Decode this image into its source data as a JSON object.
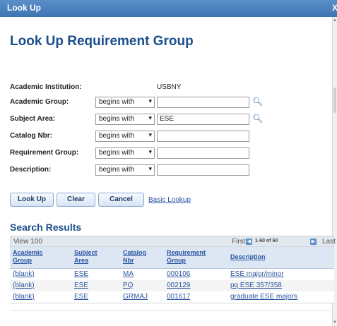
{
  "window": {
    "title": "Look Up",
    "close_label": "X"
  },
  "heading": "Look Up Requirement Group",
  "form": {
    "institution": {
      "label": "Academic Institution:",
      "value": "USBNY"
    },
    "fields": [
      {
        "label": "Academic Group:",
        "operator": "begins with",
        "value": "",
        "has_lookup": true
      },
      {
        "label": "Subject Area:",
        "operator": "begins with",
        "value": "ESE",
        "has_lookup": true
      },
      {
        "label": "Catalog Nbr:",
        "operator": "begins with",
        "value": "",
        "has_lookup": false
      },
      {
        "label": "Requirement Group:",
        "operator": "begins with",
        "value": "",
        "has_lookup": false
      },
      {
        "label": "Description:",
        "operator": "begins with",
        "value": "",
        "has_lookup": false
      }
    ]
  },
  "buttons": {
    "lookup": "Look Up",
    "clear": "Clear",
    "cancel": "Cancel",
    "basic_lookup": "Basic Lookup"
  },
  "results": {
    "title": "Search Results",
    "view": "View 100",
    "first": "First",
    "range": "1-60 of 60",
    "last": "Last",
    "columns": [
      [
        "Academic",
        "Group"
      ],
      [
        "Subject",
        "Area"
      ],
      [
        "Catalog",
        "Nbr"
      ],
      [
        "Requirement",
        "Group"
      ],
      [
        "Description",
        ""
      ]
    ],
    "rows": [
      [
        "(blank)",
        "ESE",
        "MA",
        "000106",
        "ESE major/minor"
      ],
      [
        "(blank)",
        "ESE",
        "PQ",
        "002129",
        "pq ESE 357/358"
      ],
      [
        "(blank)",
        "ESE",
        "GRMAJ",
        "001617",
        "graduate ESE majors"
      ]
    ]
  }
}
